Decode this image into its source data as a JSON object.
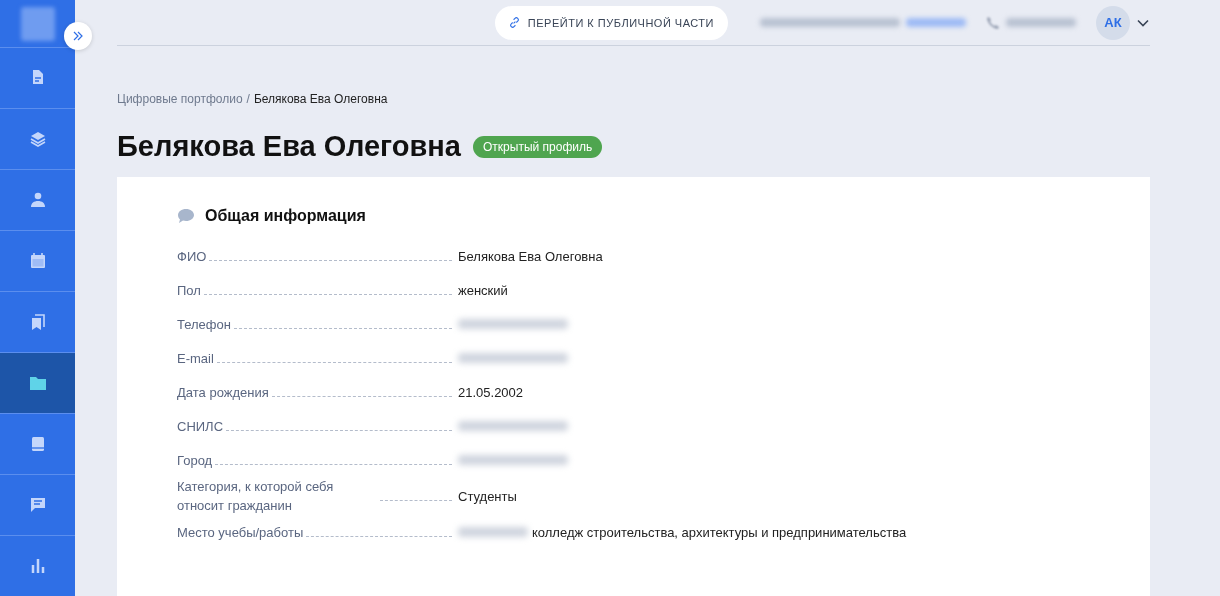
{
  "sidebar": {
    "items": [
      {
        "selected": false
      },
      {
        "selected": false
      },
      {
        "selected": false
      },
      {
        "selected": false
      },
      {
        "selected": false
      },
      {
        "selected": true
      },
      {
        "selected": false
      },
      {
        "selected": false
      },
      {
        "selected": false
      }
    ]
  },
  "header": {
    "public_button": "ПЕРЕЙТИ К ПУБЛИЧНОЙ ЧАСТИ",
    "avatar": "АК"
  },
  "breadcrumbs": [
    "Цифровые портфолио",
    "Белякова Ева Олеговна"
  ],
  "breadcrumb_separator": "/",
  "title": "Белякова Ева Олеговна",
  "status_badge": "Открытый профиль",
  "section": {
    "title": "Общая информация",
    "fields": [
      {
        "label": "ФИО",
        "value": "Белякова Ева Олеговна",
        "redacted": false
      },
      {
        "label": "Пол",
        "value": "женский",
        "redacted": false
      },
      {
        "label": "Телефон",
        "redacted": true
      },
      {
        "label": "E-mail",
        "redacted": true
      },
      {
        "label": "Дата рождения",
        "value": "21.05.2002",
        "redacted": false
      },
      {
        "label": "СНИЛС",
        "redacted": true
      },
      {
        "label": "Город",
        "redacted": true
      },
      {
        "label": "Категория, к которой себя относит гражданин",
        "value": "Студенты",
        "redacted": false
      },
      {
        "label": "Место учебы/работы",
        "value": "колледж строительства, архитектуры и предпринимательства",
        "redacted": true
      }
    ]
  }
}
